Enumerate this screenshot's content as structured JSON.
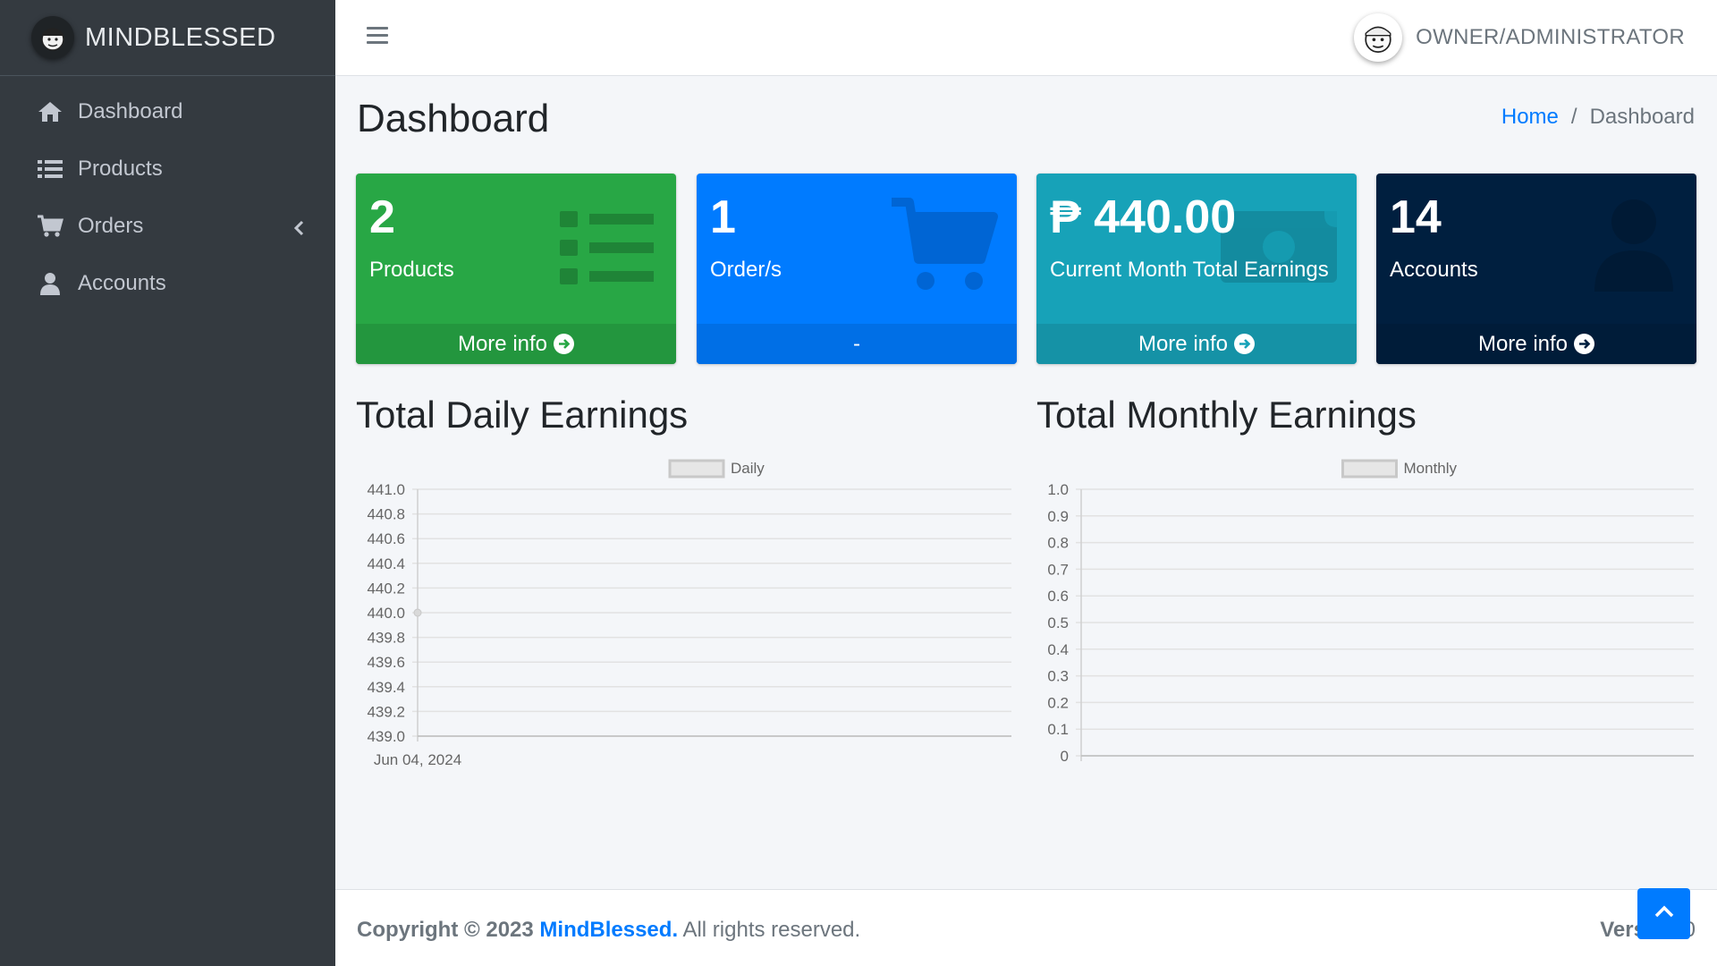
{
  "brand": {
    "name": "MINDBLESSED"
  },
  "sidebar": {
    "items": [
      {
        "label": "Dashboard",
        "icon": "home-icon"
      },
      {
        "label": "Products",
        "icon": "list-icon"
      },
      {
        "label": "Orders",
        "icon": "cart-icon"
      },
      {
        "label": "Accounts",
        "icon": "user-icon"
      }
    ]
  },
  "header": {
    "user_role": "OWNER/ADMINISTRATOR"
  },
  "page": {
    "title": "Dashboard"
  },
  "breadcrumb": {
    "home": "Home",
    "separator": "/",
    "current": "Dashboard"
  },
  "boxes": [
    {
      "value": "2",
      "label": "Products",
      "footer": "More info",
      "color": "#28a745",
      "icon": "list-icon"
    },
    {
      "value": "1",
      "label": "Order/s",
      "footer": "-",
      "color": "#007bff",
      "icon": "cart-icon"
    },
    {
      "value": "₱ 440.00",
      "label": "Current Month Total Earnings",
      "footer": "More info",
      "color": "#17a2b8",
      "icon": "money-icon"
    },
    {
      "value": "14",
      "label": "Accounts",
      "footer": "More info",
      "color": "#001f3f",
      "icon": "user-icon"
    }
  ],
  "charts": {
    "daily_title": "Total Daily Earnings",
    "monthly_title": "Total Monthly Earnings"
  },
  "chart_data": [
    {
      "type": "line",
      "title": "Total Daily Earnings",
      "legend": "Daily",
      "legend_position": "top",
      "x": [
        "Jun 04, 2024"
      ],
      "series": [
        {
          "name": "Daily",
          "values": [
            440
          ]
        }
      ],
      "ylim": [
        439.0,
        441.0
      ],
      "yticks": [
        "441.0",
        "440.8",
        "440.6",
        "440.4",
        "440.2",
        "440.0",
        "439.8",
        "439.6",
        "439.4",
        "439.2",
        "439.0"
      ],
      "grid": true
    },
    {
      "type": "line",
      "title": "Total Monthly Earnings",
      "legend": "Monthly",
      "legend_position": "top",
      "x": [],
      "series": [
        {
          "name": "Monthly",
          "values": []
        }
      ],
      "ylim": [
        0,
        1.0
      ],
      "yticks": [
        "1.0",
        "0.9",
        "0.8",
        "0.7",
        "0.6",
        "0.5",
        "0.4",
        "0.3",
        "0.2",
        "0.1",
        "0"
      ],
      "grid": true
    }
  ],
  "footer": {
    "copyright_prefix": "Copyright © 2023 ",
    "company": "MindBlessed.",
    "rights": " All rights reserved.",
    "version_label": "Version",
    "version_value": "0"
  }
}
